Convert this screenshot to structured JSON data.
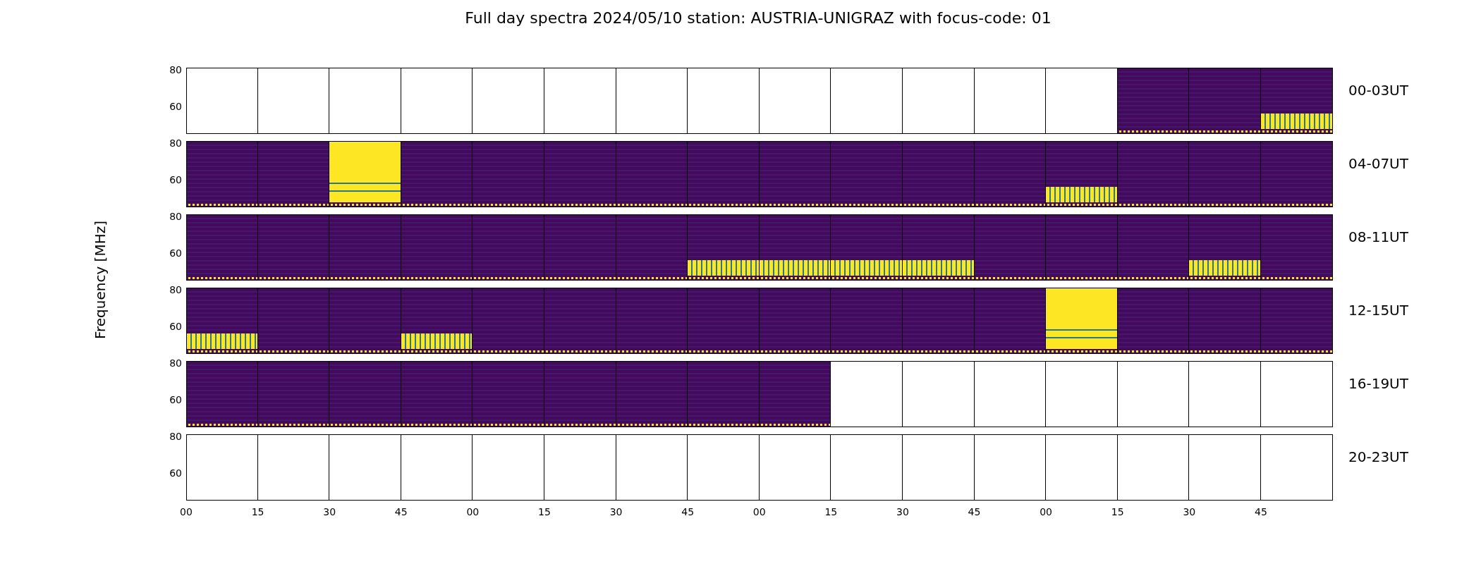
{
  "title": "Full day spectra 2024/05/10 station: AUSTRIA-UNIGRAZ with focus-code: 01",
  "ylabel": "Frequency [MHz]",
  "rows": [
    {
      "label": "00-03UT",
      "y_ticks": [
        "80",
        "60"
      ],
      "panels": [
        {
          "kind": "empty"
        },
        {
          "kind": "empty"
        },
        {
          "kind": "empty"
        },
        {
          "kind": "empty"
        },
        {
          "kind": "empty"
        },
        {
          "kind": "empty"
        },
        {
          "kind": "empty"
        },
        {
          "kind": "empty"
        },
        {
          "kind": "empty"
        },
        {
          "kind": "empty"
        },
        {
          "kind": "empty"
        },
        {
          "kind": "empty"
        },
        {
          "kind": "empty"
        },
        {
          "kind": "quiet"
        },
        {
          "kind": "quiet"
        },
        {
          "kind": "band"
        }
      ]
    },
    {
      "label": "04-07UT",
      "y_ticks": [
        "80",
        "60"
      ],
      "panels": [
        {
          "kind": "quiet"
        },
        {
          "kind": "quiet"
        },
        {
          "kind": "full"
        },
        {
          "kind": "quiet"
        },
        {
          "kind": "quiet"
        },
        {
          "kind": "quiet"
        },
        {
          "kind": "quiet"
        },
        {
          "kind": "quiet"
        },
        {
          "kind": "quiet"
        },
        {
          "kind": "quiet"
        },
        {
          "kind": "quiet"
        },
        {
          "kind": "quiet"
        },
        {
          "kind": "band"
        },
        {
          "kind": "quiet"
        },
        {
          "kind": "quiet"
        },
        {
          "kind": "quiet"
        }
      ]
    },
    {
      "label": "08-11UT",
      "y_ticks": [
        "80",
        "60"
      ],
      "panels": [
        {
          "kind": "quiet"
        },
        {
          "kind": "quiet"
        },
        {
          "kind": "quiet"
        },
        {
          "kind": "quiet"
        },
        {
          "kind": "quiet"
        },
        {
          "kind": "quiet"
        },
        {
          "kind": "quiet"
        },
        {
          "kind": "band"
        },
        {
          "kind": "band"
        },
        {
          "kind": "band"
        },
        {
          "kind": "band"
        },
        {
          "kind": "quiet"
        },
        {
          "kind": "quiet"
        },
        {
          "kind": "quiet"
        },
        {
          "kind": "band"
        },
        {
          "kind": "quiet"
        }
      ]
    },
    {
      "label": "12-15UT",
      "y_ticks": [
        "80",
        "60"
      ],
      "panels": [
        {
          "kind": "band"
        },
        {
          "kind": "quiet"
        },
        {
          "kind": "quiet"
        },
        {
          "kind": "band"
        },
        {
          "kind": "quiet"
        },
        {
          "kind": "quiet"
        },
        {
          "kind": "quiet"
        },
        {
          "kind": "quiet"
        },
        {
          "kind": "quiet"
        },
        {
          "kind": "quiet"
        },
        {
          "kind": "quiet"
        },
        {
          "kind": "quiet"
        },
        {
          "kind": "full"
        },
        {
          "kind": "quiet"
        },
        {
          "kind": "quiet"
        },
        {
          "kind": "quiet"
        }
      ]
    },
    {
      "label": "16-19UT",
      "y_ticks": [
        "80",
        "60"
      ],
      "panels": [
        {
          "kind": "quiet"
        },
        {
          "kind": "quiet"
        },
        {
          "kind": "quiet"
        },
        {
          "kind": "quiet"
        },
        {
          "kind": "quiet"
        },
        {
          "kind": "quiet"
        },
        {
          "kind": "quiet"
        },
        {
          "kind": "quiet"
        },
        {
          "kind": "quiet"
        },
        {
          "kind": "empty"
        },
        {
          "kind": "empty"
        },
        {
          "kind": "empty"
        },
        {
          "kind": "empty"
        },
        {
          "kind": "empty"
        },
        {
          "kind": "empty"
        },
        {
          "kind": "empty"
        }
      ]
    },
    {
      "label": "20-23UT",
      "y_ticks": [
        "80",
        "60"
      ],
      "panels": [
        {
          "kind": "empty"
        },
        {
          "kind": "empty"
        },
        {
          "kind": "empty"
        },
        {
          "kind": "empty"
        },
        {
          "kind": "empty"
        },
        {
          "kind": "empty"
        },
        {
          "kind": "empty"
        },
        {
          "kind": "empty"
        },
        {
          "kind": "empty"
        },
        {
          "kind": "empty"
        },
        {
          "kind": "empty"
        },
        {
          "kind": "empty"
        },
        {
          "kind": "empty"
        },
        {
          "kind": "empty"
        },
        {
          "kind": "empty"
        },
        {
          "kind": "empty"
        }
      ]
    }
  ],
  "x_ticks": [
    "00",
    "15",
    "30",
    "45",
    "00",
    "15",
    "30",
    "45",
    "00",
    "15",
    "30",
    "45",
    "00",
    "15",
    "30",
    "45"
  ]
}
